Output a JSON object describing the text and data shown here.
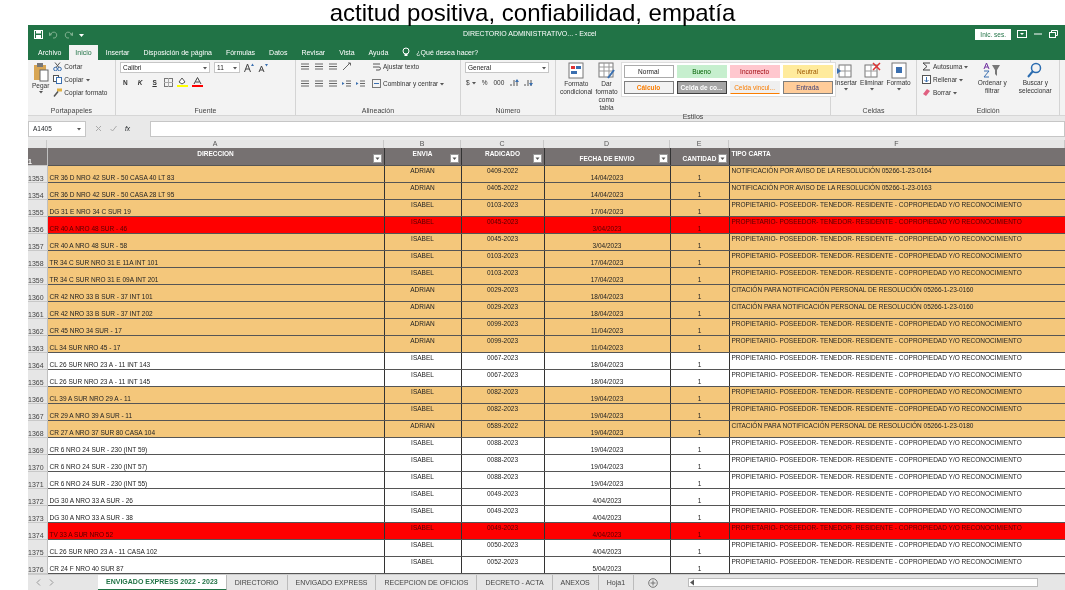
{
  "slide_heading": "actitud positiva, confiabilidad, empatía",
  "window": {
    "title": "DIRECTORIO ADMINISTRATIVO... - Excel",
    "sign_in": "Inic. ses."
  },
  "ribbon_tabs": [
    {
      "label": "Archivo",
      "selected": false
    },
    {
      "label": "Inicio",
      "selected": true
    },
    {
      "label": "Insertar",
      "selected": false
    },
    {
      "label": "Disposición de página",
      "selected": false
    },
    {
      "label": "Fórmulas",
      "selected": false
    },
    {
      "label": "Datos",
      "selected": false
    },
    {
      "label": "Revisar",
      "selected": false
    },
    {
      "label": "Vista",
      "selected": false
    },
    {
      "label": "Ayuda",
      "selected": false
    }
  ],
  "tell_me": "¿Qué desea hacer?",
  "ribbon": {
    "clipboard": {
      "paste": "Pegar",
      "commands": [
        "Cortar",
        "Copiar",
        "Copiar formato"
      ],
      "label": "Portapapeles"
    },
    "font": {
      "name": "Calibri",
      "size": "11",
      "style_buttons": [
        "N",
        "K",
        "S"
      ],
      "label": "Fuente"
    },
    "alignment": {
      "commands": [
        "Ajustar texto",
        "Combinar y centrar"
      ],
      "label": "Alineación"
    },
    "number": {
      "format": "General",
      "symbols": [
        "$",
        "%",
        "000"
      ],
      "label": "Número"
    },
    "styles": {
      "commands": [
        "Formato condicional",
        "Dar formato como tabla"
      ],
      "cell_styles": [
        {
          "label": "Normal",
          "kind": "normal"
        },
        {
          "label": "Bueno",
          "kind": "good"
        },
        {
          "label": "Incorrecto",
          "kind": "bad"
        },
        {
          "label": "Neutral",
          "kind": "neutral"
        },
        {
          "label": "Cálculo",
          "kind": "calculation"
        },
        {
          "label": "Celda de co...",
          "kind": "check"
        },
        {
          "label": "Celda vincul...",
          "kind": "linked"
        },
        {
          "label": "Entrada",
          "kind": "input"
        }
      ],
      "label": "Estilos"
    },
    "cells": {
      "commands": [
        "Insertar",
        "Eliminar",
        "Formato"
      ],
      "label": "Celdas"
    },
    "editing": {
      "commands": [
        "Autosuma",
        "Rellenar",
        "Borrar"
      ],
      "big_commands": [
        "Ordenar y filtrar",
        "Buscar y seleccionar"
      ],
      "label": "Edición"
    }
  },
  "formula_bar": {
    "name_box": "A1405",
    "function_label": "fx"
  },
  "sheet": {
    "header_row_number": "1",
    "columns": [
      {
        "letter": "A",
        "header": "DIRECCION",
        "filter": true
      },
      {
        "letter": "B",
        "header": "ENVIA",
        "filter": true
      },
      {
        "letter": "C",
        "header": "RADICADO",
        "filter": true
      },
      {
        "letter": "D",
        "header": "FECHA DE ENVIO",
        "filter": true
      },
      {
        "letter": "E",
        "header": "CANTIDAD",
        "filter": true
      },
      {
        "letter": "F",
        "header": "TIPO CARTA",
        "filter": false
      }
    ],
    "rows": [
      {
        "number": "1353",
        "color": "#f4c77b",
        "cells": [
          "CR 36 D NRO 42 SUR - 50 CASA 40 LT 83",
          "ADRIAN",
          "0409-2022",
          "14/04/2023",
          "1",
          "NOTIFICACIÓN POR AVISO DE LA RESOLUCIÓN 05266-1-23-0164"
        ]
      },
      {
        "number": "1354",
        "color": "#f4c77b",
        "cells": [
          "CR 36 D NRO 42 SUR - 50 CASA 28 LT 95",
          "ADRIAN",
          "0405-2022",
          "14/04/2023",
          "1",
          "NOTIFICACIÓN POR AVISO DE LA RESOLUCIÓN 05266-1-23-0163"
        ]
      },
      {
        "number": "1355",
        "color": "#f4c77b",
        "cells": [
          "DG 31 E NRO 34 C SUR 19",
          "ISABEL",
          "0103-2023",
          "17/04/2023",
          "1",
          "PROPIETARIO- POSEEDOR- TENEDOR- RESIDENTE - COPROPIEDAD Y/O RECONOCIMIENTO"
        ]
      },
      {
        "number": "1356",
        "color": "#ff0000",
        "cells": [
          "CR 40 A NRO 48 SUR - 46",
          "ISABEL",
          "0045-2023",
          "3/04/2023",
          "1",
          "PROPIETARIO- POSEEDOR- TENEDOR- RESIDENTE - COPROPIEDAD Y/O RECONOCIMIENTO"
        ]
      },
      {
        "number": "1357",
        "color": "#f4c77b",
        "cells": [
          "CR 40 A NRO 48 SUR - 58",
          "ISABEL",
          "0045-2023",
          "3/04/2023",
          "1",
          "PROPIETARIO- POSEEDOR- TENEDOR- RESIDENTE - COPROPIEDAD Y/O RECONOCIMIENTO"
        ]
      },
      {
        "number": "1358",
        "color": "#f4c77b",
        "cells": [
          "TR 34 C SUR NRO 31 E 11A INT 101",
          "ISABEL",
          "0103-2023",
          "17/04/2023",
          "1",
          "PROPIETARIO- POSEEDOR- TENEDOR- RESIDENTE - COPROPIEDAD Y/O RECONOCIMIENTO"
        ]
      },
      {
        "number": "1359",
        "color": "#f4c77b",
        "cells": [
          "TR 34 C SUR NRO 31 E 09A INT 201",
          "ISABEL",
          "0103-2023",
          "17/04/2023",
          "1",
          "PROPIETARIO- POSEEDOR- TENEDOR- RESIDENTE - COPROPIEDAD Y/O RECONOCIMIENTO"
        ]
      },
      {
        "number": "1360",
        "color": "#f4c77b",
        "cells": [
          "CR 42 NRO 33 B SUR - 37 INT 101",
          "ADRIAN",
          "0029-2023",
          "18/04/2023",
          "1",
          "CITACIÓN PARA NOTIFICACIÓN PERSONAL DE RESOLUCIÓN 05266-1-23-0160"
        ]
      },
      {
        "number": "1361",
        "color": "#f4c77b",
        "cells": [
          "CR 42 NRO 33 B SUR - 37 INT 202",
          "ADRIAN",
          "0029-2023",
          "18/04/2023",
          "1",
          "CITACIÓN PARA NOTIFICACIÓN PERSONAL DE RESOLUCIÓN 05266-1-23-0160"
        ]
      },
      {
        "number": "1362",
        "color": "#f4c77b",
        "cells": [
          "CR 45 NRO 34 SUR - 17",
          "ADRIAN",
          "0099-2023",
          "11/04/2023",
          "1",
          "PROPIETARIO- POSEEDOR- TENEDOR- RESIDENTE - COPROPIEDAD Y/O RECONOCIMIENTO"
        ]
      },
      {
        "number": "1363",
        "color": "#f4c77b",
        "cells": [
          "CL 34 SUR NRO 45 - 17",
          "ADRIAN",
          "0099-2023",
          "11/04/2023",
          "1",
          "PROPIETARIO- POSEEDOR- TENEDOR- RESIDENTE - COPROPIEDAD Y/O RECONOCIMIENTO"
        ]
      },
      {
        "number": "1364",
        "color": "#ffffff",
        "cells": [
          "CL 26 SUR NRO 23 A - 11 INT 143",
          "ISABEL",
          "0067-2023",
          "18/04/2023",
          "1",
          "PROPIETARIO- POSEEDOR- TENEDOR- RESIDENTE - COPROPIEDAD Y/O RECONOCIMIENTO"
        ]
      },
      {
        "number": "1365",
        "color": "#ffffff",
        "cells": [
          "CL 26 SUR NRO 23 A - 11 INT 145",
          "ISABEL",
          "0067-2023",
          "18/04/2023",
          "1",
          "PROPIETARIO- POSEEDOR- TENEDOR- RESIDENTE - COPROPIEDAD Y/O RECONOCIMIENTO"
        ]
      },
      {
        "number": "1366",
        "color": "#f4c77b",
        "cells": [
          "CL 39 A SUR NRO 29 A - 11",
          "ISABEL",
          "0082-2023",
          "19/04/2023",
          "1",
          "PROPIETARIO- POSEEDOR- TENEDOR- RESIDENTE - COPROPIEDAD Y/O RECONOCIMIENTO"
        ]
      },
      {
        "number": "1367",
        "color": "#f4c77b",
        "cells": [
          "CR 29 A NRO 39 A SUR - 11",
          "ISABEL",
          "0082-2023",
          "19/04/2023",
          "1",
          "PROPIETARIO- POSEEDOR- TENEDOR- RESIDENTE - COPROPIEDAD Y/O RECONOCIMIENTO"
        ]
      },
      {
        "number": "1368",
        "color": "#f4c77b",
        "cells": [
          "CR 27 A NRO 37 SUR 80 CASA 104",
          "ADRIAN",
          "0589-2022",
          "19/04/2023",
          "1",
          "CITACIÓN PARA NOTIFICACIÓN PERSONAL DE RESOLUCIÓN 05266-1-23-0180"
        ]
      },
      {
        "number": "1369",
        "color": "#ffffff",
        "cells": [
          "CR 6 NRO 24 SUR - 230 (INT 59)",
          "ISABEL",
          "0088-2023",
          "19/04/2023",
          "1",
          "PROPIETARIO- POSEEDOR- TENEDOR- RESIDENTE - COPROPIEDAD Y/O RECONOCIMIENTO"
        ]
      },
      {
        "number": "1370",
        "color": "#ffffff",
        "cells": [
          "CR 6 NRO 24 SUR - 230 (INT 57)",
          "ISABEL",
          "0088-2023",
          "19/04/2023",
          "1",
          "PROPIETARIO- POSEEDOR- TENEDOR- RESIDENTE - COPROPIEDAD Y/O RECONOCIMIENTO"
        ]
      },
      {
        "number": "1371",
        "color": "#ffffff",
        "cells": [
          "CR 6 NRO 24 SUR - 230 (INT 55)",
          "ISABEL",
          "0088-2023",
          "19/04/2023",
          "1",
          "PROPIETARIO- POSEEDOR- TENEDOR- RESIDENTE - COPROPIEDAD Y/O RECONOCIMIENTO"
        ]
      },
      {
        "number": "1372",
        "color": "#ffffff",
        "cells": [
          "DG 30 A NRO 33 A SUR - 26",
          "ISABEL",
          "0049-2023",
          "4/04/2023",
          "1",
          "PROPIETARIO- POSEEDOR- TENEDOR- RESIDENTE - COPROPIEDAD Y/O RECONOCIMIENTO"
        ]
      },
      {
        "number": "1373",
        "color": "#ffffff",
        "cells": [
          "DG 30 A NRO 33 A SUR - 38",
          "ISABEL",
          "0049-2023",
          "4/04/2023",
          "1",
          "PROPIETARIO- POSEEDOR- TENEDOR- RESIDENTE - COPROPIEDAD Y/O RECONOCIMIENTO"
        ]
      },
      {
        "number": "1374",
        "color": "#ff0000",
        "cells": [
          "TV 33 A SUR NRO 52",
          "ISABEL",
          "0049-2023",
          "4/04/2023",
          "1",
          "PROPIETARIO- POSEEDOR- TENEDOR- RESIDENTE - COPROPIEDAD Y/O RECONOCIMIENTO"
        ]
      },
      {
        "number": "1375",
        "color": "#ffffff",
        "cells": [
          "CL 26 SUR NRO 23 A - 11 CASA 102",
          "ISABEL",
          "0050-2023",
          "4/04/2023",
          "1",
          "PROPIETARIO- POSEEDOR- TENEDOR- RESIDENTE - COPROPIEDAD Y/O RECONOCIMIENTO"
        ]
      },
      {
        "number": "1376",
        "color": "#ffffff",
        "cells": [
          "CR 24 F NRO 40 SUR 87",
          "ISABEL",
          "0052-2023",
          "5/04/2023",
          "1",
          "PROPIETARIO- POSEEDOR- TENEDOR- RESIDENTE - COPROPIEDAD Y/O RECONOCIMIENTO"
        ]
      }
    ]
  },
  "sheet_tabs": [
    {
      "label": "ENVIGADO EXPRESS 2022 - 2023",
      "selected": true
    },
    {
      "label": "DIRECTORIO",
      "selected": false
    },
    {
      "label": "ENVIGADO EXPRESS",
      "selected": false
    },
    {
      "label": "RECEPCION DE OFICIOS",
      "selected": false
    },
    {
      "label": "DECRETO - ACTA",
      "selected": false
    },
    {
      "label": "ANEXOS",
      "selected": false
    },
    {
      "label": "Hoja1",
      "selected": false
    }
  ]
}
